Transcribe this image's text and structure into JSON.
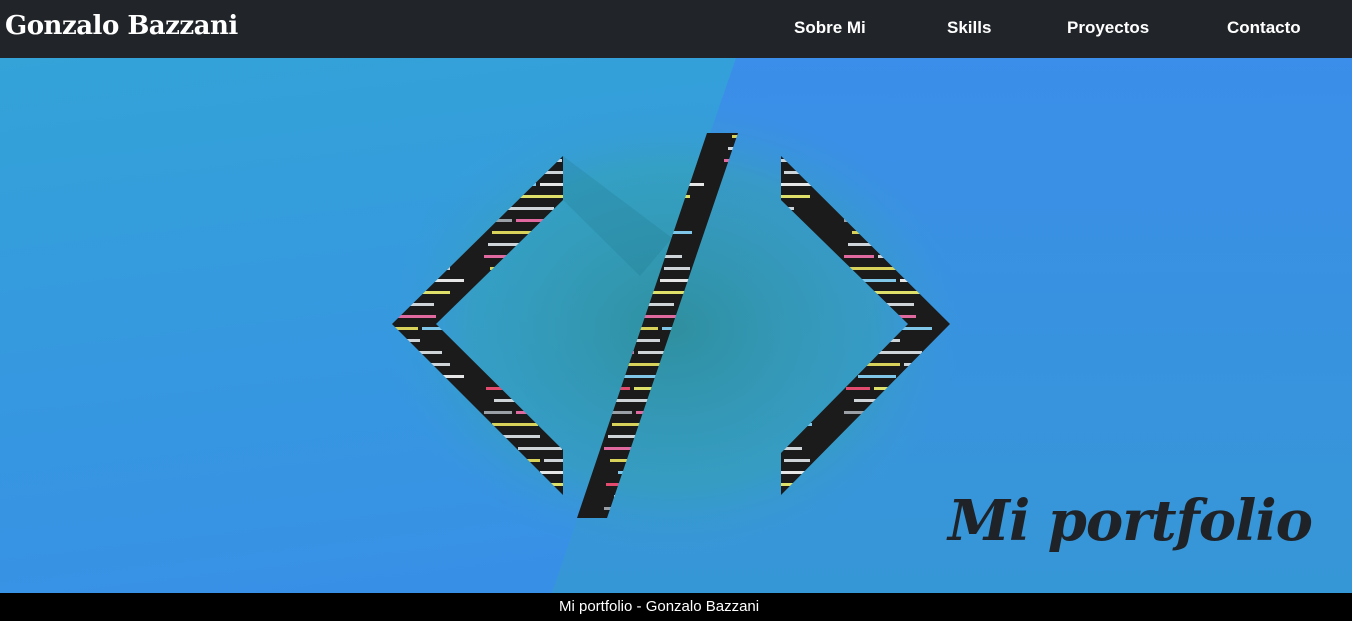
{
  "navbar": {
    "brand": "Gonzalo Bazzani",
    "links": [
      "Sobre Mi",
      "Skills",
      "Proyectos",
      "Contacto"
    ]
  },
  "hero": {
    "title": "Mi portfolio",
    "logo_icon": "code-brackets-icon"
  },
  "footer": {
    "text": "Mi portfolio - Gonzalo Bazzani"
  },
  "colors": {
    "navbar_bg": "#212529",
    "hero_light_blue": "#32a9e0",
    "hero_blue": "#3a8de8",
    "footer_bg": "#000000",
    "logo_dark": "#1c1c1c"
  }
}
